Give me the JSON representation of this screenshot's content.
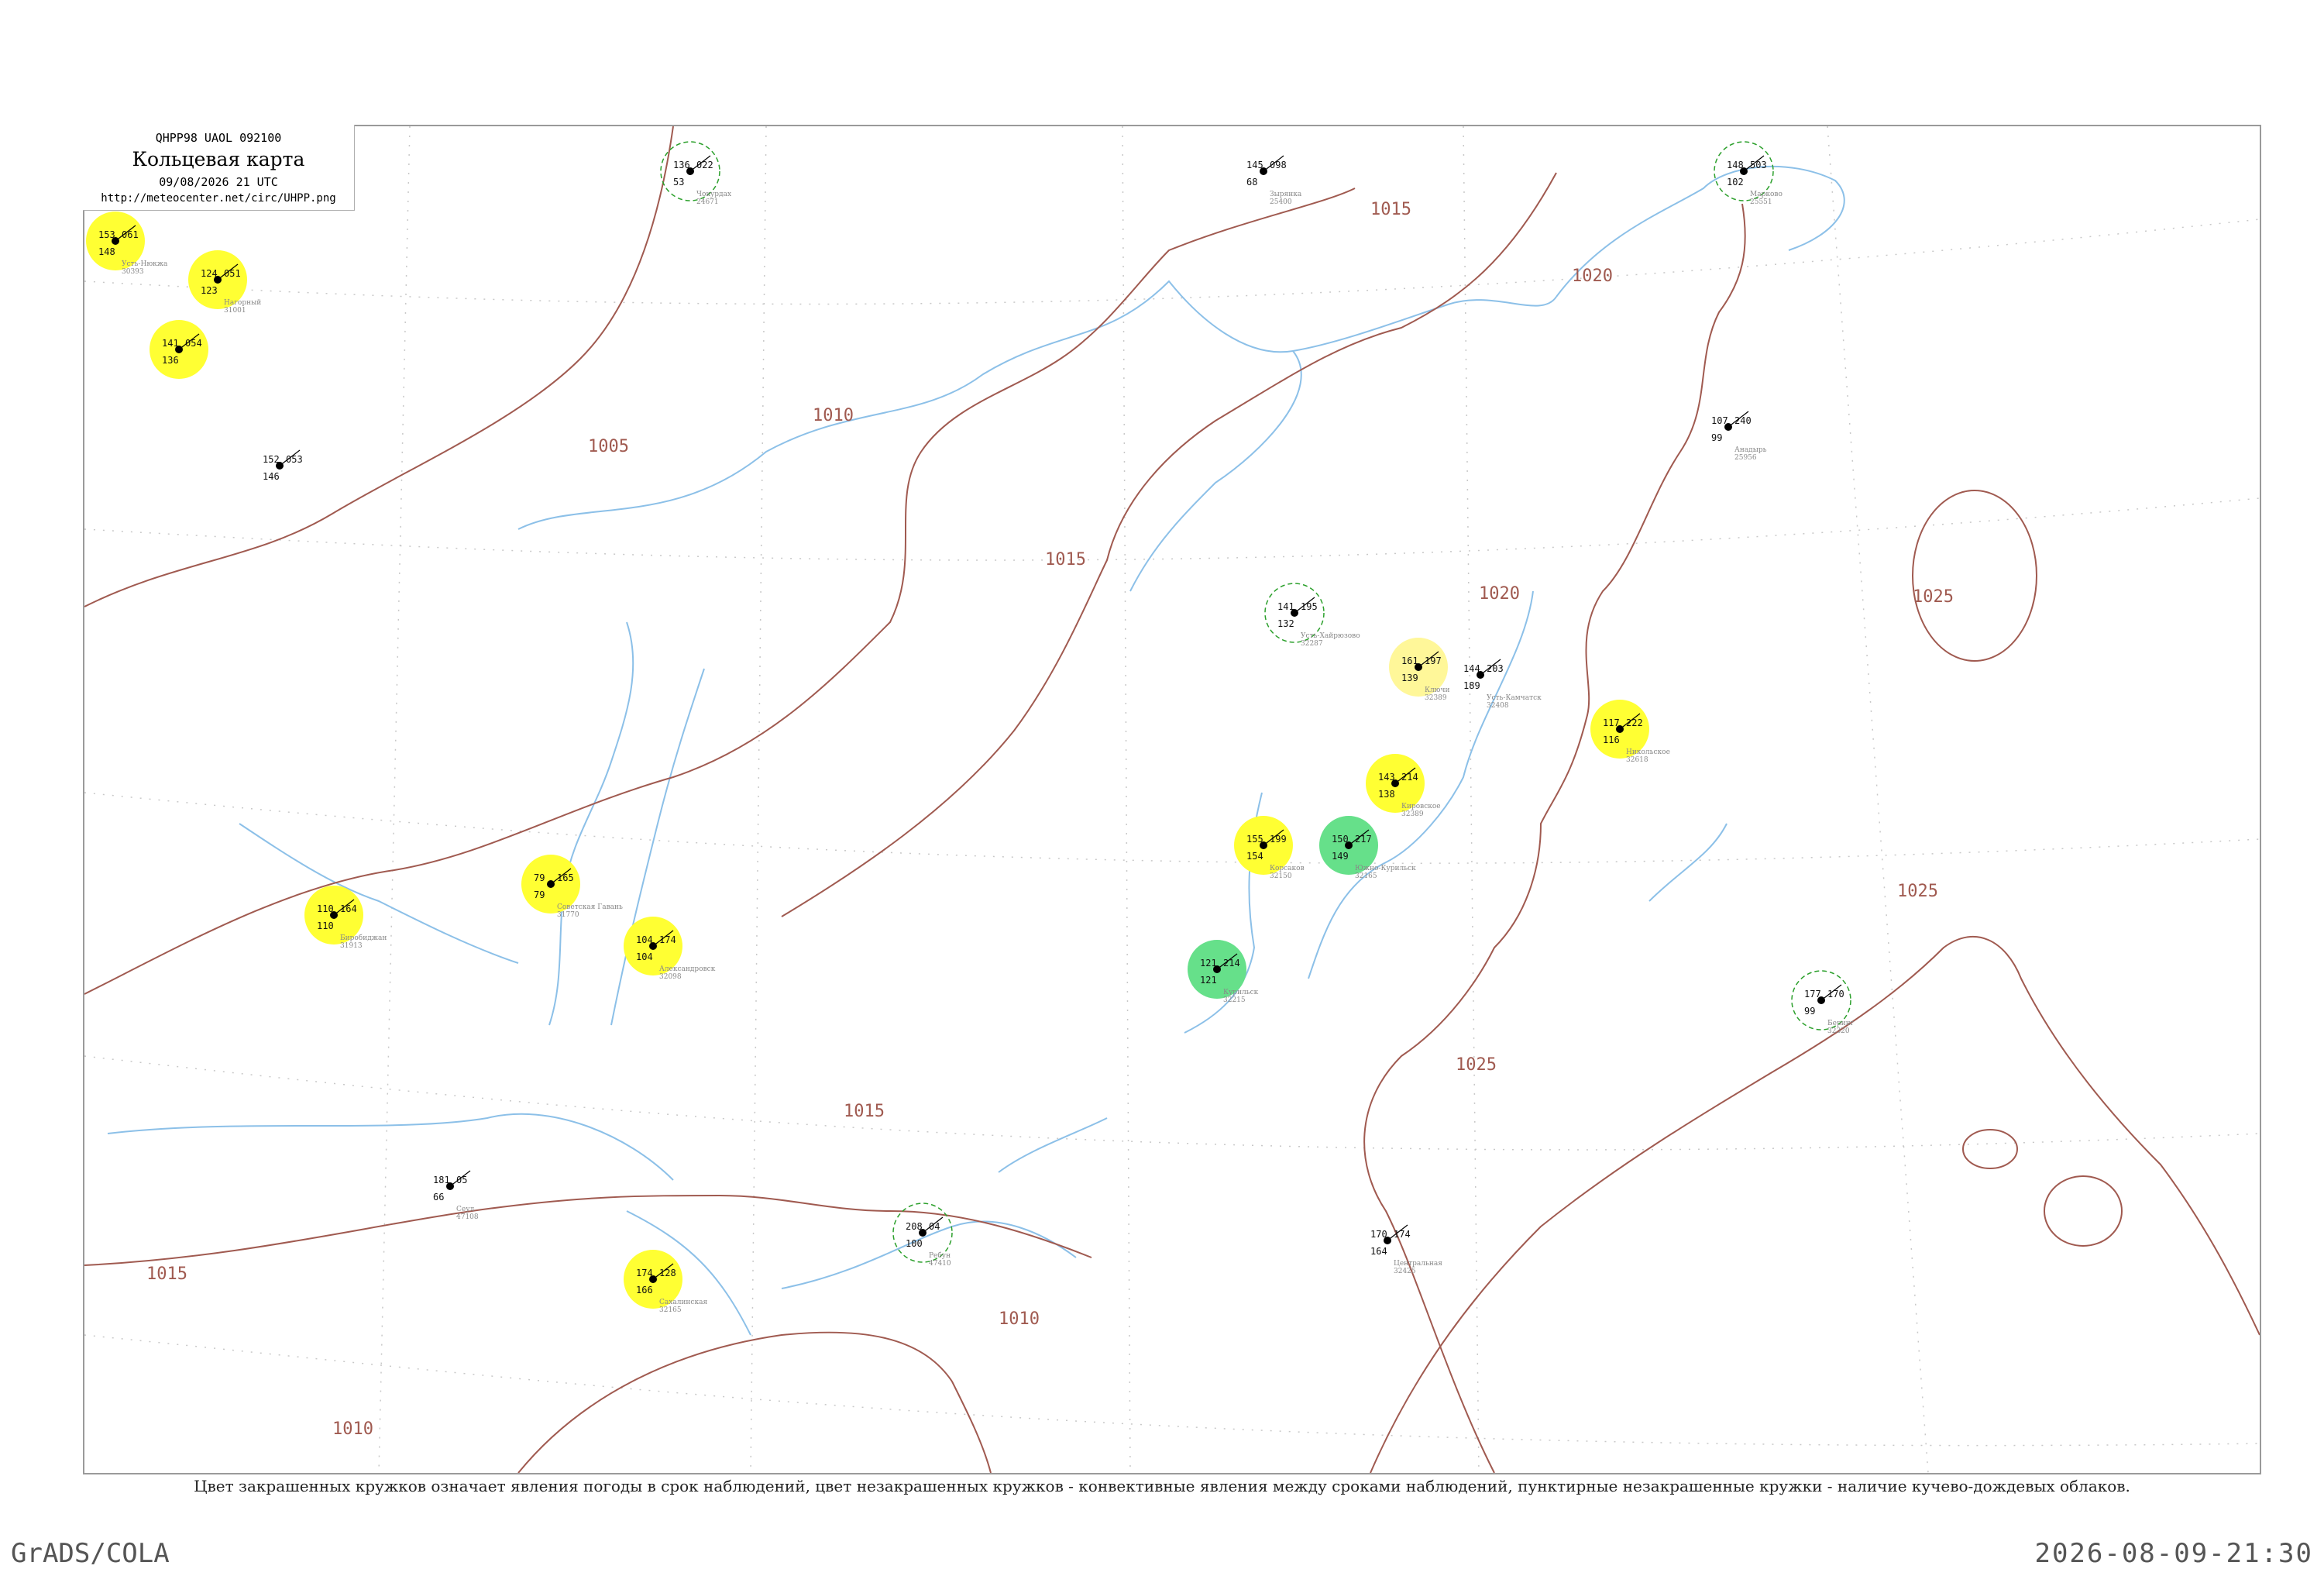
{
  "header": {
    "code": "QHPP98  UAOL  092100",
    "title": "Кольцевая карта",
    "date": "09/08/2026 21 UTC",
    "url": "http://meteocenter.net/circ/UHPP.png"
  },
  "footnote": "Цвет закрашенных кружков означает явления погоды в срок наблюдений, цвет незакрашенных кружков - конвективные явления между сроками наблюдений, пунктирные незакрашенные кружки - наличие кучево-дождевых облаков.",
  "footer": {
    "brand": "GrADS/COLA",
    "timestamp": "2026-08-09-21:30"
  },
  "colors": {
    "isobar": "#a05a50",
    "water": "#8cc0e8",
    "yellow": "#ffff33",
    "green": "#1fbf3a",
    "light_green": "#66e08a",
    "pale_yellow": "#fff799",
    "ring": "#2ca02c"
  },
  "isobars": [
    {
      "label": "1005"
    },
    {
      "label": "1010"
    },
    {
      "label": "1015"
    },
    {
      "label": "1020"
    },
    {
      "label": "1025"
    }
  ],
  "stations": [
    {
      "t": "153",
      "p": "061",
      "d": "148",
      "name": "Усть-Нюкжа",
      "id": "30393",
      "fill": "yellow"
    },
    {
      "t": "124",
      "p": "051",
      "d": "123",
      "name": "Нагорный",
      "id": "31001",
      "fill": "yellow"
    },
    {
      "t": "141",
      "p": "054",
      "d": "136",
      "name": "",
      "id": "",
      "fill": "yellow"
    },
    {
      "t": "110",
      "p": "164",
      "d": "110",
      "name": "Биробиджан",
      "id": "31913",
      "fill": "yellow"
    },
    {
      "t": "79",
      "p": "165",
      "d": "79",
      "name": "Советская Гавань",
      "id": "31770",
      "fill": "yellow"
    },
    {
      "t": "104",
      "p": "174",
      "d": "104",
      "name": "Александровск",
      "id": "32098",
      "fill": "yellow"
    },
    {
      "t": "155",
      "p": "199",
      "d": "154",
      "name": "Корсаков",
      "id": "32150",
      "fill": "yellow"
    },
    {
      "t": "143",
      "p": "214",
      "d": "138",
      "name": "Кировское",
      "id": "32389",
      "fill": "yellow"
    },
    {
      "t": "117",
      "p": "222",
      "d": "116",
      "name": "Никольское",
      "id": "32618",
      "fill": "yellow"
    },
    {
      "t": "174",
      "p": "128",
      "d": "166",
      "name": "Сахалинская",
      "id": "32165",
      "fill": "yellow"
    },
    {
      "t": "161",
      "p": "197",
      "d": "139",
      "name": "Ключи",
      "id": "32389",
      "fill": "pale_yellow"
    },
    {
      "t": "150",
      "p": "217",
      "d": "149",
      "name": "Южно-Курильск",
      "id": "32165",
      "fill": "light_green"
    },
    {
      "t": "121",
      "p": "214",
      "d": "121",
      "name": "Курильск",
      "id": "32215",
      "fill": "light_green"
    },
    {
      "t": "152",
      "p": "053",
      "d": "146",
      "name": "",
      "id": "",
      "fill": "none"
    },
    {
      "t": "141",
      "p": "195",
      "d": "132",
      "name": "Усть-Хайрюзово",
      "id": "32287",
      "fill": "none"
    },
    {
      "t": "144",
      "p": "203",
      "d": "189",
      "name": "Усть-Камчатск",
      "id": "32408",
      "fill": "none"
    },
    {
      "t": "136",
      "p": "022",
      "d": "53",
      "name": "Чокурдах",
      "id": "24671",
      "fill": "none"
    },
    {
      "t": "145",
      "p": "098",
      "d": "68",
      "name": "Зырянка",
      "id": "25400",
      "fill": "none"
    },
    {
      "t": "148",
      "p": "503",
      "d": "102",
      "name": "Марково",
      "id": "25551",
      "fill": "none"
    },
    {
      "t": "107",
      "p": "240",
      "d": "99",
      "name": "Анадырь",
      "id": "25956",
      "fill": "none"
    },
    {
      "t": "177",
      "p": "170",
      "d": "99",
      "name": "Беринг",
      "id": "32320",
      "fill": "none"
    },
    {
      "t": "170",
      "p": "174",
      "d": "164",
      "name": "Центральная",
      "id": "32425",
      "fill": "none"
    },
    {
      "t": "208",
      "p": "04",
      "d": "100",
      "name": "Ребун",
      "id": "47410",
      "fill": "none"
    },
    {
      "t": "181",
      "p": "05",
      "d": "66",
      "name": "Сеул",
      "id": "47108",
      "fill": "none"
    }
  ]
}
